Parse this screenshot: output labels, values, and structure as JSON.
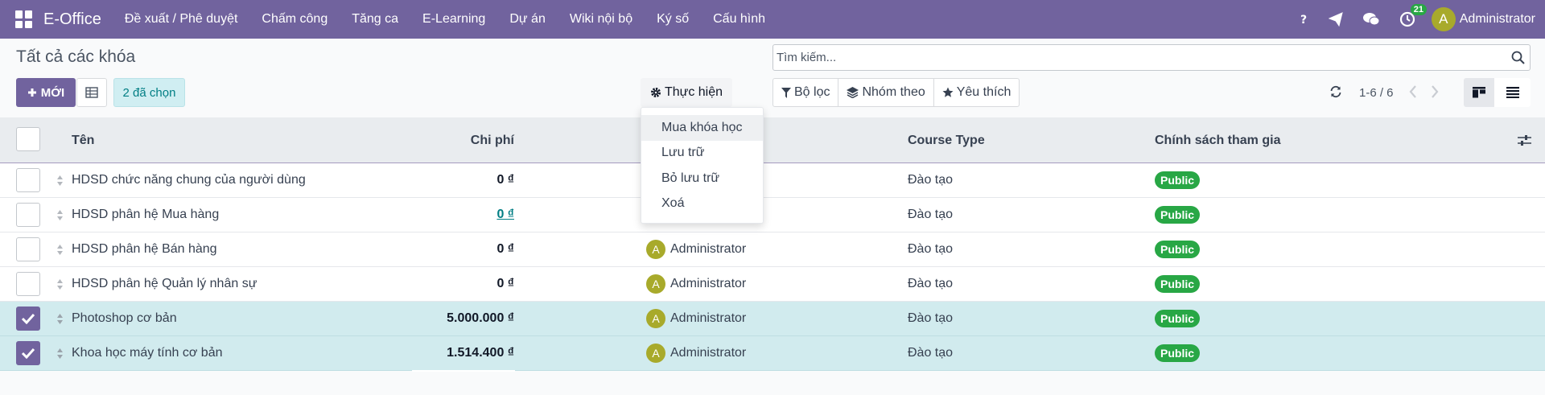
{
  "navbar": {
    "brand": "E-Office",
    "menu": [
      "Đề xuất / Phê duyệt",
      "Chấm công",
      "Tăng ca",
      "E-Learning",
      "Dự án",
      "Wiki nội bộ",
      "Ký số",
      "Cấu hình"
    ],
    "activity_count": "21",
    "user_initial": "A",
    "user_name": "Administrator",
    "accent": "#71639e"
  },
  "control_panel": {
    "title": "Tất cả các khóa",
    "new_label": "MỚI",
    "selected_label": "2 đã chọn",
    "action_label": "Thực hiện",
    "search_placeholder": "Tìm kiếm...",
    "filters": [
      "Bộ lọc",
      "Nhóm theo",
      "Yêu thích"
    ],
    "pager": "1-6 / 6"
  },
  "action_menu": {
    "items": [
      "Mua khóa học",
      "Lưu trữ",
      "Bỏ lưu trữ",
      "Xoá"
    ]
  },
  "table": {
    "columns": {
      "name": "Tên",
      "cost": "Chi phí",
      "course_type": "Course Type",
      "policy": "Chính sách tham gia"
    },
    "rows": [
      {
        "name": "HDSD chức năng chung của người dùng",
        "cost": "0 ₫",
        "responsible": "",
        "initial": "",
        "type": "Đào tạo",
        "policy": "Public",
        "selected": false
      },
      {
        "name": "HDSD phân hệ Mua hàng",
        "cost": "0 ₫",
        "responsible": "",
        "initial": "",
        "type": "Đào tạo",
        "policy": "Public",
        "selected": false
      },
      {
        "name": "HDSD phân hệ Bán hàng",
        "cost": "0 ₫",
        "responsible": "Administrator",
        "initial": "A",
        "type": "Đào tạo",
        "policy": "Public",
        "selected": false
      },
      {
        "name": "HDSD phân hệ Quản lý nhân sự",
        "cost": "0 ₫",
        "responsible": "Administrator",
        "initial": "A",
        "type": "Đào tạo",
        "policy": "Public",
        "selected": false
      },
      {
        "name": "Photoshop cơ bản",
        "cost": "5.000.000 ₫",
        "responsible": "Administrator",
        "initial": "A",
        "type": "Đào tạo",
        "policy": "Public",
        "selected": true
      },
      {
        "name": "Khoa học máy tính cơ bản",
        "cost": "1.514.400 ₫",
        "responsible": "Administrator",
        "initial": "A",
        "type": "Đào tạo",
        "policy": "Public",
        "selected": true
      }
    ]
  }
}
